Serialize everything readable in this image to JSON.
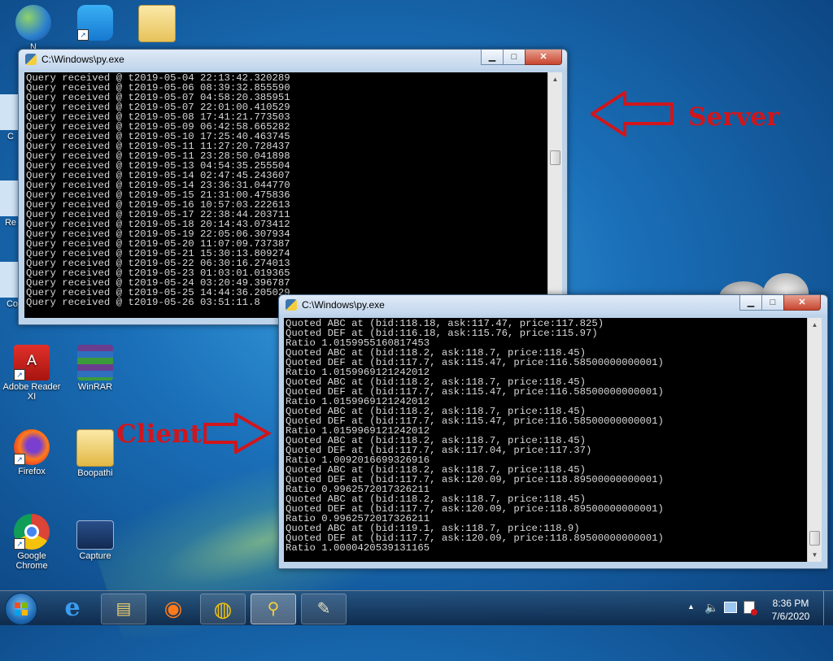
{
  "desktop": {
    "icons": [
      {
        "label": "N",
        "icon": "network-icon"
      },
      {
        "label": "",
        "icon": "shareit-icon"
      },
      {
        "label": "",
        "icon": "folder-icon"
      },
      {
        "label": "C",
        "icon": "partial-icon"
      },
      {
        "label": "Re",
        "icon": "partial-icon"
      },
      {
        "label": "Co",
        "icon": "partial-icon"
      },
      {
        "label": "Adobe Reader XI",
        "icon": "adobe-reader-icon"
      },
      {
        "label": "WinRAR",
        "icon": "winrar-icon"
      },
      {
        "label": "Firefox",
        "icon": "firefox-icon"
      },
      {
        "label": "Boopathi",
        "icon": "folder-icon"
      },
      {
        "label": "Google Chrome",
        "icon": "chrome-icon"
      },
      {
        "label": "Capture",
        "icon": "image-icon"
      }
    ]
  },
  "server_window": {
    "title": "C:\\Windows\\py.exe",
    "minimize": "▁",
    "maximize": "□",
    "close": "✕",
    "lines": [
      "Query received @ t2019-05-04 22:13:42.320289",
      "Query received @ t2019-05-06 08:39:32.855590",
      "Query received @ t2019-05-07 04:58:20.385951",
      "Query received @ t2019-05-07 22:01:00.410529",
      "Query received @ t2019-05-08 17:41:21.773503",
      "Query received @ t2019-05-09 06:42:58.665282",
      "Query received @ t2019-05-10 17:25:40.463745",
      "Query received @ t2019-05-11 11:27:20.728437",
      "Query received @ t2019-05-11 23:28:50.041898",
      "Query received @ t2019-05-13 04:54:35.255504",
      "Query received @ t2019-05-14 02:47:45.243607",
      "Query received @ t2019-05-14 23:36:31.044770",
      "Query received @ t2019-05-15 21:31:00.475836",
      "Query received @ t2019-05-16 10:57:03.222613",
      "Query received @ t2019-05-17 22:38:44.203711",
      "Query received @ t2019-05-18 20:14:43.073412",
      "Query received @ t2019-05-19 22:05:06.307934",
      "Query received @ t2019-05-20 11:07:09.737387",
      "Query received @ t2019-05-21 15:30:13.809274",
      "Query received @ t2019-05-22 06:30:16.274013",
      "Query received @ t2019-05-23 01:03:01.019365",
      "Query received @ t2019-05-24 03:20:49.396787",
      "Query received @ t2019-05-25 14:44:36.205029",
      "Query received @ t2019-05-26 03:51:11.8"
    ]
  },
  "client_window": {
    "title": "C:\\Windows\\py.exe",
    "minimize": "▁",
    "maximize": "□",
    "close": "✕",
    "lines": [
      "Quoted ABC at (bid:118.18, ask:117.47, price:117.825)",
      "Quoted DEF at (bid:116.18, ask:115.76, price:115.97)",
      "Ratio 1.0159955160817453",
      "Quoted ABC at (bid:118.2, ask:118.7, price:118.45)",
      "Quoted DEF at (bid:117.7, ask:115.47, price:116.58500000000001)",
      "Ratio 1.0159969121242012",
      "Quoted ABC at (bid:118.2, ask:118.7, price:118.45)",
      "Quoted DEF at (bid:117.7, ask:115.47, price:116.58500000000001)",
      "Ratio 1.0159969121242012",
      "Quoted ABC at (bid:118.2, ask:118.7, price:118.45)",
      "Quoted DEF at (bid:117.7, ask:115.47, price:116.58500000000001)",
      "Ratio 1.0159969121242012",
      "Quoted ABC at (bid:118.2, ask:118.7, price:118.45)",
      "Quoted DEF at (bid:117.7, ask:117.04, price:117.37)",
      "Ratio 1.0092016699326916",
      "Quoted ABC at (bid:118.2, ask:118.7, price:118.45)",
      "Quoted DEF at (bid:117.7, ask:120.09, price:118.89500000000001)",
      "Ratio 0.9962572017326211",
      "Quoted ABC at (bid:118.2, ask:118.7, price:118.45)",
      "Quoted DEF at (bid:117.7, ask:120.09, price:118.89500000000001)",
      "Ratio 0.9962572017326211",
      "Quoted ABC at (bid:119.1, ask:118.7, price:118.9)",
      "Quoted DEF at (bid:117.7, ask:120.09, price:118.89500000000001)",
      "Ratio 1.0000420539131165"
    ]
  },
  "annotations": {
    "server_label": "Server",
    "client_label": "Client",
    "color": "#d0161c"
  },
  "taskbar": {
    "pinned": [
      {
        "name": "ie-icon",
        "glyph": "e"
      },
      {
        "name": "explorer-icon",
        "glyph": "▤"
      },
      {
        "name": "firefox-icon",
        "glyph": "◉"
      },
      {
        "name": "chrome-icon",
        "glyph": "◍"
      },
      {
        "name": "python-icon",
        "glyph": "⚲"
      },
      {
        "name": "paint-icon",
        "glyph": "✎"
      }
    ],
    "tray_icons": [
      "show-hidden-icon",
      "volume-icon",
      "network-icon",
      "action-center-icon"
    ],
    "tray_arrow": "▲",
    "time": "8:36 PM",
    "date": "7/6/2020"
  }
}
